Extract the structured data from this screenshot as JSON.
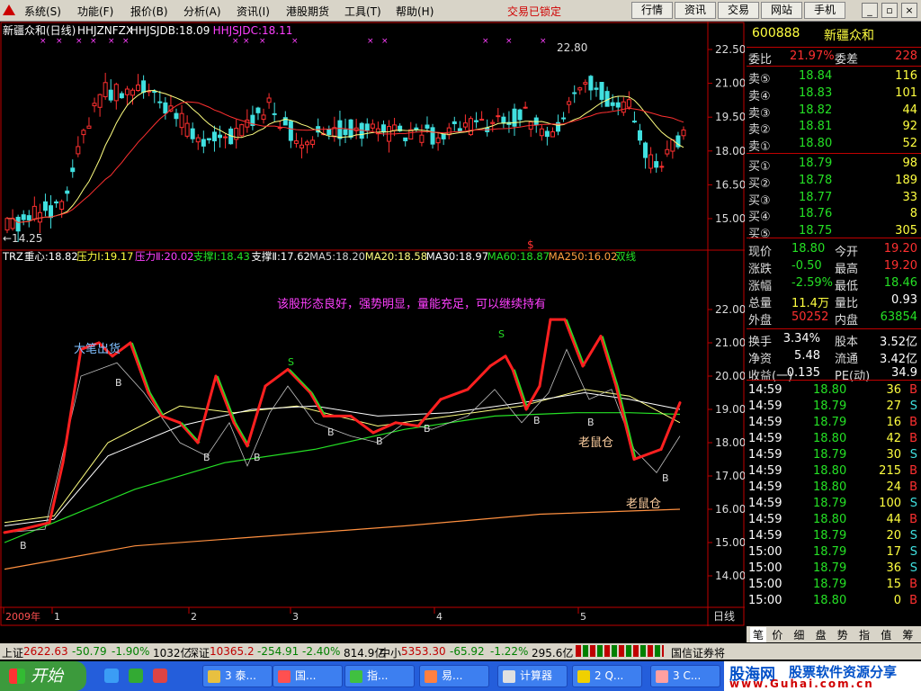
{
  "menu": {
    "items": [
      "系统(S)",
      "功能(F)",
      "报价(B)",
      "分析(A)",
      "资讯(I)",
      "港股期货",
      "工具(T)",
      "帮助(H)"
    ],
    "lock_status": "交易已锁定",
    "right_buttons": [
      "行情",
      "资讯",
      "交易",
      "网站",
      "手机"
    ]
  },
  "chart": {
    "title": "新疆众和(日线)",
    "indicators": [
      {
        "label": "HHJZNFZX",
        "color": "#ffffff"
      },
      {
        "label": "HHJSJDB:18.09",
        "color": "#ffffff"
      },
      {
        "label": "HHJSJDC:18.11",
        "color": "#ff40ff"
      }
    ],
    "price_axis": [
      "22.50",
      "21.00",
      "19.50",
      "18.00",
      "16.50",
      "15.00"
    ],
    "high_label": "22.80",
    "low_label": "←14.25",
    "dollar_marker": "$",
    "lower_header": [
      {
        "label": "TRZ",
        "color": "#ffffff"
      },
      {
        "label": "重心:18.82",
        "color": "#ffffff"
      },
      {
        "label": "压力Ⅰ:19.17",
        "color": "#ffff40"
      },
      {
        "label": "压力Ⅱ:20.02",
        "color": "#ff40ff"
      },
      {
        "label": "支撑Ⅰ:18.43",
        "color": "#25e025"
      },
      {
        "label": "支撑Ⅱ:17.62",
        "color": "#ffffff"
      },
      {
        "label": "MA5:18.20",
        "color": "#d0d0d0"
      },
      {
        "label": "MA20:18.58",
        "color": "#ffff80"
      },
      {
        "label": "MA30:18.97",
        "color": "#ffffff"
      },
      {
        "label": "MA60:18.87",
        "color": "#25e025"
      },
      {
        "label": "MA250:16.02",
        "color": "#ffa040"
      },
      {
        "label": "双线",
        "color": "#25e025"
      }
    ],
    "lower_axis": [
      "22.00",
      "21.00",
      "20.00",
      "19.00",
      "18.00",
      "17.00",
      "16.00",
      "15.00",
      "14.00"
    ],
    "annotation": "该股形态良好，强势明显，量能充足，可以继续持有",
    "label_top": "大笔出货",
    "label_rat1": "老鼠仓",
    "label_rat2": "老鼠仓",
    "month_labels": [
      "2009年",
      "1",
      "2",
      "3",
      "4",
      "5"
    ],
    "period": "日线"
  },
  "chart_data": {
    "type": "candlestick",
    "title": "新疆众和(日线)",
    "upper_y_range": [
      14.25,
      22.8
    ],
    "lower_y_range": [
      14.0,
      22.0
    ],
    "upper_y_ticks": [
      22.5,
      21.0,
      19.5,
      18.0,
      16.5,
      15.0
    ],
    "lower_y_ticks": [
      22,
      21,
      20,
      19,
      18,
      17,
      16,
      15,
      14
    ],
    "highest": 22.8,
    "lowest": 14.25,
    "indicator_values": {
      "重心": 18.82,
      "压力Ⅰ": 19.17,
      "压力Ⅱ": 20.02,
      "支撑Ⅰ": 18.43,
      "支撑Ⅱ": 17.62,
      "MA5": 18.2,
      "MA20": 18.58,
      "MA30": 18.97,
      "MA60": 18.87,
      "MA250": 16.02
    }
  },
  "quote": {
    "code": "600888",
    "name": "新疆众和",
    "wb_label": "委比",
    "wb_value": "21.97%",
    "wc_label": "委差",
    "wc_value": "228",
    "sells": [
      {
        "label": "卖⑤",
        "price": "18.84",
        "vol": "116"
      },
      {
        "label": "卖④",
        "price": "18.83",
        "vol": "101"
      },
      {
        "label": "卖③",
        "price": "18.82",
        "vol": "44"
      },
      {
        "label": "卖②",
        "price": "18.81",
        "vol": "92"
      },
      {
        "label": "卖①",
        "price": "18.80",
        "vol": "52"
      }
    ],
    "buys": [
      {
        "label": "买①",
        "price": "18.79",
        "vol": "98"
      },
      {
        "label": "买②",
        "price": "18.78",
        "vol": "189"
      },
      {
        "label": "买③",
        "price": "18.77",
        "vol": "33"
      },
      {
        "label": "买④",
        "price": "18.76",
        "vol": "8"
      },
      {
        "label": "买⑤",
        "price": "18.75",
        "vol": "305"
      }
    ],
    "stats": [
      {
        "l1": "现价",
        "v1": "18.80",
        "c1": "grn",
        "l2": "今开",
        "v2": "19.20",
        "c2": "red"
      },
      {
        "l1": "涨跌",
        "v1": "-0.50",
        "c1": "grn",
        "l2": "最高",
        "v2": "19.20",
        "c2": "red"
      },
      {
        "l1": "涨幅",
        "v1": "-2.59%",
        "c1": "grn",
        "l2": "最低",
        "v2": "18.46",
        "c2": "grn"
      },
      {
        "l1": "总量",
        "v1": "11.4万",
        "c1": "yel",
        "l2": "量比",
        "v2": "0.93",
        "c2": "wht"
      },
      {
        "l1": "外盘",
        "v1": "50252",
        "c1": "red",
        "l2": "内盘",
        "v2": "63854",
        "c2": "grn"
      }
    ],
    "stats2": [
      {
        "l1": "换手",
        "v1": "3.34%",
        "c1": "wht",
        "l2": "股本",
        "v2": "3.52亿",
        "c2": "wht"
      },
      {
        "l1": "净资",
        "v1": "5.48",
        "c1": "wht",
        "l2": "流通",
        "v2": "3.42亿",
        "c2": "wht"
      },
      {
        "l1": "收益(一)",
        "v1": "0.135",
        "c1": "wht",
        "l2": "PE(动)",
        "v2": "34.9",
        "c2": "wht"
      }
    ],
    "ticks": [
      {
        "time": "14:59",
        "price": "18.80",
        "vol": "36",
        "bs": "B"
      },
      {
        "time": "14:59",
        "price": "18.79",
        "vol": "27",
        "bs": "S"
      },
      {
        "time": "14:59",
        "price": "18.79",
        "vol": "16",
        "bs": "B"
      },
      {
        "time": "14:59",
        "price": "18.80",
        "vol": "42",
        "bs": "B"
      },
      {
        "time": "14:59",
        "price": "18.79",
        "vol": "30",
        "bs": "S"
      },
      {
        "time": "14:59",
        "price": "18.80",
        "vol": "215",
        "bs": "B"
      },
      {
        "time": "14:59",
        "price": "18.80",
        "vol": "24",
        "bs": "B"
      },
      {
        "time": "14:59",
        "price": "18.79",
        "vol": "100",
        "bs": "S"
      },
      {
        "time": "14:59",
        "price": "18.80",
        "vol": "44",
        "bs": "B"
      },
      {
        "time": "14:59",
        "price": "18.79",
        "vol": "20",
        "bs": "S"
      },
      {
        "time": "15:00",
        "price": "18.79",
        "vol": "17",
        "bs": "S"
      },
      {
        "time": "15:00",
        "price": "18.79",
        "vol": "36",
        "bs": "S"
      },
      {
        "time": "15:00",
        "price": "18.79",
        "vol": "15",
        "bs": "B"
      },
      {
        "time": "15:00",
        "price": "18.80",
        "vol": "0",
        "bs": "B"
      }
    ],
    "tabs": [
      "笔",
      "价",
      "细",
      "盘",
      "势",
      "指",
      "值",
      "筹"
    ]
  },
  "index_bar": {
    "sh_label": "上证",
    "sh_val": "2622.63",
    "sh_chg": "-50.79",
    "sh_pct": "-1.90%",
    "sh_amt": "1032亿",
    "sz_label": "深证",
    "sz_val": "10365.2",
    "sz_chg": "-254.91",
    "sz_pct": "-2.40%",
    "sz_amt": "814.9亿",
    "zx_label": "中小",
    "zx_val": "5353.30",
    "zx_chg": "-65.92",
    "zx_pct": "-1.22%",
    "zx_amt": "295.6亿",
    "broker": "国信证券将"
  },
  "taskbar": {
    "start": "开始",
    "tasks": [
      "3 泰...",
      "国...",
      "指...",
      "易...",
      "计算器",
      "2 Q...",
      "3 C..."
    ],
    "logo_main": "股海网",
    "logo_sub": "股票软件资源分享",
    "logo_url": "www.Guhai.com.cn"
  }
}
